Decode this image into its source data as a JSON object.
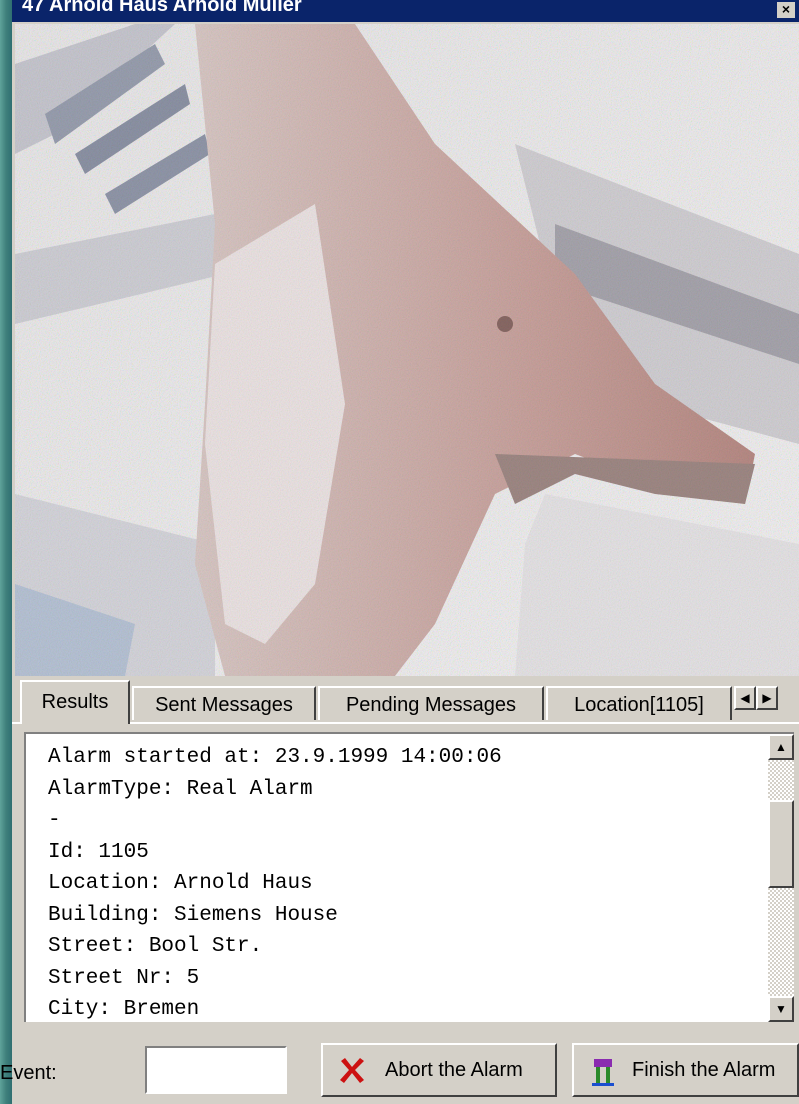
{
  "window": {
    "title": "47  Arnold Haus Arnold  Muller",
    "close_glyph": "×"
  },
  "tabs": [
    {
      "label": "Results",
      "active": true
    },
    {
      "label": "Sent Messages",
      "active": false
    },
    {
      "label": "Pending Messages",
      "active": false
    },
    {
      "label": "Location[1105]",
      "active": false
    }
  ],
  "tab_scroll": {
    "left_icon": "triangle-left-icon",
    "right_icon": "triangle-right-icon"
  },
  "results": {
    "lines": [
      "Alarm started at: 23.9.1999 14:00:06",
      "AlarmType: Real Alarm",
      "-",
      "Id: 1105",
      "Location: Arnold Haus",
      "Building: Siemens House",
      "Street: Bool Str.",
      "Street Nr: 5",
      "City: Bremen"
    ]
  },
  "bottom": {
    "event_label": "Event:",
    "event_value": "",
    "abort_label": "Abort the Alarm",
    "finish_label": "Finish the Alarm"
  },
  "colors": {
    "title_bar": "#0a246a",
    "face": "#d4d0c8",
    "abort_icon": "#cc1111"
  }
}
